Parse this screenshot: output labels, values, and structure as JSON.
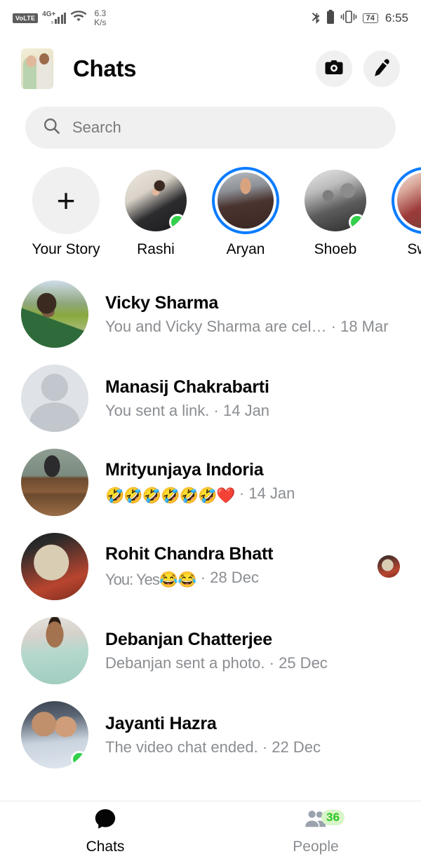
{
  "statusbar": {
    "volte": "VoLTE",
    "network": "4G+",
    "speed_value": "6.3",
    "speed_unit": "K/s",
    "bluetooth_icon": "bluetooth-icon",
    "vibrate_icon": "vibrate-icon",
    "battery_percent": "74",
    "time": "6:55"
  },
  "header": {
    "avatar_name": "profile-avatar",
    "title": "Chats",
    "camera_label": "camera-icon",
    "compose_label": "compose-pencil-icon"
  },
  "search": {
    "placeholder": "Search",
    "icon": "search-icon"
  },
  "stories": [
    {
      "name": "Your Story",
      "type": "add",
      "ring": false,
      "online": false
    },
    {
      "name": "Rashi",
      "type": "photo",
      "ring": false,
      "online": true
    },
    {
      "name": "Aryan",
      "type": "photo",
      "ring": true,
      "online": false
    },
    {
      "name": "Shoeb",
      "type": "photo",
      "ring": false,
      "online": true
    },
    {
      "name": "Sway",
      "type": "photo",
      "ring": true,
      "online": false
    }
  ],
  "chats": [
    {
      "name": "Vicky Sharma",
      "snippet": "You and Vicky Sharma are cel…",
      "time": "18 Mar",
      "avatar": "photo",
      "online": false,
      "seen": false
    },
    {
      "name": "Manasij Chakrabarti",
      "snippet": "You sent a link.",
      "time": "14 Jan",
      "avatar": "silhouette",
      "online": false,
      "seen": false
    },
    {
      "name": "Mrityunjaya Indoria",
      "snippet": "🤣🤣🤣🤣🤣🤣❤️",
      "time": "14 Jan",
      "avatar": "photo",
      "online": false,
      "seen": false
    },
    {
      "name": "Rohit Chandra Bhatt",
      "snippet": "You: Yes😂😂",
      "time": "28 Dec",
      "avatar": "photo",
      "online": false,
      "seen": true
    },
    {
      "name": "Debanjan Chatterjee",
      "snippet": "Debanjan sent a photo.",
      "time": "25 Dec",
      "avatar": "photo",
      "online": false,
      "seen": false
    },
    {
      "name": "Jayanti Hazra",
      "snippet": "The video chat ended.",
      "time": "22 Dec",
      "avatar": "photo",
      "online": true,
      "seen": false
    }
  ],
  "bottomnav": [
    {
      "label": "Chats",
      "icon": "chat-bubble-icon",
      "active": true,
      "badge": ""
    },
    {
      "label": "People",
      "icon": "people-icon",
      "active": false,
      "badge": "36"
    }
  ],
  "colors": {
    "accent_blue": "#0a7cff",
    "online_green": "#31d14a",
    "badge_green": "#2cc422",
    "badge_bg": "#d8f5c8",
    "primary_text": "#050505",
    "secondary_text": "#8a8d91",
    "field_bg": "#f0f0f0"
  },
  "separator": "·"
}
